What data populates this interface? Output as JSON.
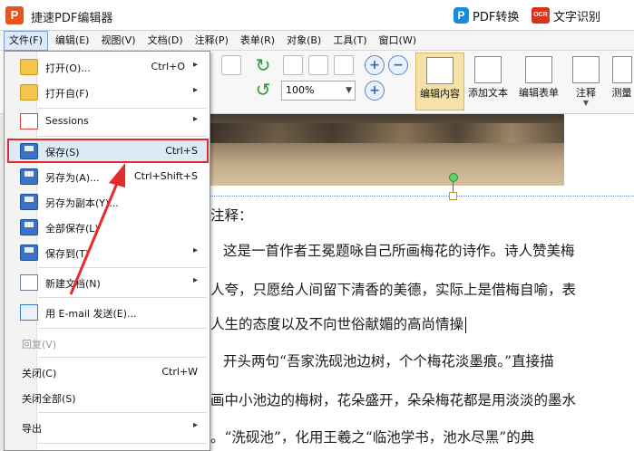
{
  "app": {
    "logo_text": "P",
    "title": "捷速PDF编辑器",
    "pdf_convert_label": "PDF转换",
    "ocr_badge": "OCR",
    "ocr_label": "文字识别"
  },
  "menubar": {
    "items": [
      "文件(F)",
      "编辑(E)",
      "视图(V)",
      "文档(D)",
      "注释(P)",
      "表单(R)",
      "对象(B)",
      "工具(T)",
      "窗口(W)"
    ]
  },
  "toolbar": {
    "zoom_value": "100%",
    "buttons": {
      "edit_content": "编辑内容",
      "add_text": "添加文本",
      "edit_form": "编辑表单",
      "annotate": "注释",
      "measure": "测量"
    }
  },
  "file_menu": {
    "items": [
      {
        "label": "打开(O)...",
        "shortcut": "Ctrl+O",
        "submenu": true
      },
      {
        "label": "打开自(F)",
        "shortcut": "",
        "submenu": true
      },
      {
        "label": "Sessions",
        "shortcut": "",
        "submenu": true
      },
      {
        "label": "保存(S)",
        "shortcut": "Ctrl+S",
        "submenu": false
      },
      {
        "label": "另存为(A)...",
        "shortcut": "Ctrl+Shift+S",
        "submenu": false
      },
      {
        "label": "另存为副本(Y)...",
        "shortcut": "",
        "submenu": false
      },
      {
        "label": "全部保存(L)",
        "shortcut": "",
        "submenu": false
      },
      {
        "label": "保存到(T)",
        "shortcut": "",
        "submenu": true
      },
      {
        "label": "新建文档(N)",
        "shortcut": "",
        "submenu": true
      },
      {
        "label": "用 E-mail 发送(E)...",
        "shortcut": "",
        "submenu": false
      },
      {
        "label": "回复(V)",
        "shortcut": "",
        "submenu": false
      },
      {
        "label": "关闭(C)",
        "shortcut": "Ctrl+W",
        "submenu": false
      },
      {
        "label": "关闭全部(S)",
        "shortcut": "",
        "submenu": false
      },
      {
        "label": "导出",
        "shortcut": "",
        "submenu": true
      }
    ],
    "submenu_arrow": "▸"
  },
  "document": {
    "lines": [
      "注释：",
      "这是一首作者王冕题咏自己所画梅花的诗作。诗人赞美梅",
      "人夸，只愿给人间留下清香的美德，实际上是借梅自喻，表",
      "人生的态度以及不向世俗献媚的高尚情操",
      "开头两句“吾家洗砚池边树，个个梅花淡墨痕。”直接描",
      "画中小池边的梅树，花朵盛开，朵朵梅花都是用淡淡的墨水",
      "。“洗砚池”，化用王羲之“临池学书，池水尽黑”的典"
    ]
  }
}
